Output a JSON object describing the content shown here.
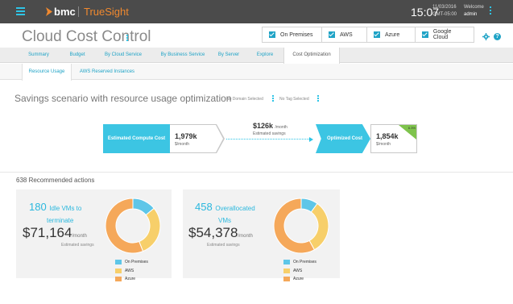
{
  "topbar": {
    "brand": "bmc",
    "product": "TrueSight",
    "time": "15:07",
    "date": "11/03/2016",
    "timezone": "GMT-05:00",
    "welcome_label": "Welcome",
    "user": "admin"
  },
  "header": {
    "title": "Cloud Cost Control",
    "filters": [
      "On Premises",
      "AWS",
      "Azure",
      "Google Cloud"
    ]
  },
  "nav_tabs": [
    "Summary",
    "Budget",
    "By Cloud Service",
    "By Business Service",
    "By Server",
    "Explore",
    "Cost Optimization"
  ],
  "sub_tabs": [
    "Resource Usage",
    "AWS Reserved Instances"
  ],
  "scenario": {
    "title": "Savings scenario with resource usage optimization",
    "domain_filter": "No Domain Selected",
    "tag_filter": "No Tag Selected"
  },
  "flow": {
    "estimated_label": "Estimated Compute Cost",
    "estimated_value": "1,979k",
    "estimated_unit": "$/month",
    "savings_value": "$126k",
    "savings_unit": "/month",
    "savings_label": "Estimated savings",
    "optimized_label": "Optimized Cost",
    "optimized_value": "1,854k",
    "optimized_unit": "$/month",
    "savings_percent": "6.3%"
  },
  "recommended": {
    "title": "638 Recommended actions",
    "cards": [
      {
        "count": "180",
        "label_line1": "Idle VMs to",
        "label_line2": "terminate",
        "money": "$71,164",
        "money_unit": "/month",
        "est_label": "Estimated savings"
      },
      {
        "count": "458",
        "label_line1": "Overallocated",
        "label_line2": "VMs",
        "money": "$54,378",
        "money_unit": "/month",
        "est_label": "Estimated savings"
      }
    ],
    "legend": [
      "On Premises",
      "AWS",
      "Azure"
    ]
  },
  "colors": {
    "on_premises": "#5ec6e8",
    "aws": "#f7cf6a",
    "azure": "#f5a85a",
    "accent": "#1fa3c6"
  },
  "chart_data": [
    {
      "type": "pie",
      "categories": [
        "On Premises",
        "AWS",
        "Azure"
      ],
      "values": [
        14,
        30,
        56
      ]
    },
    {
      "type": "pie",
      "categories": [
        "On Premises",
        "AWS",
        "Azure"
      ],
      "values": [
        10,
        32,
        58
      ]
    }
  ]
}
